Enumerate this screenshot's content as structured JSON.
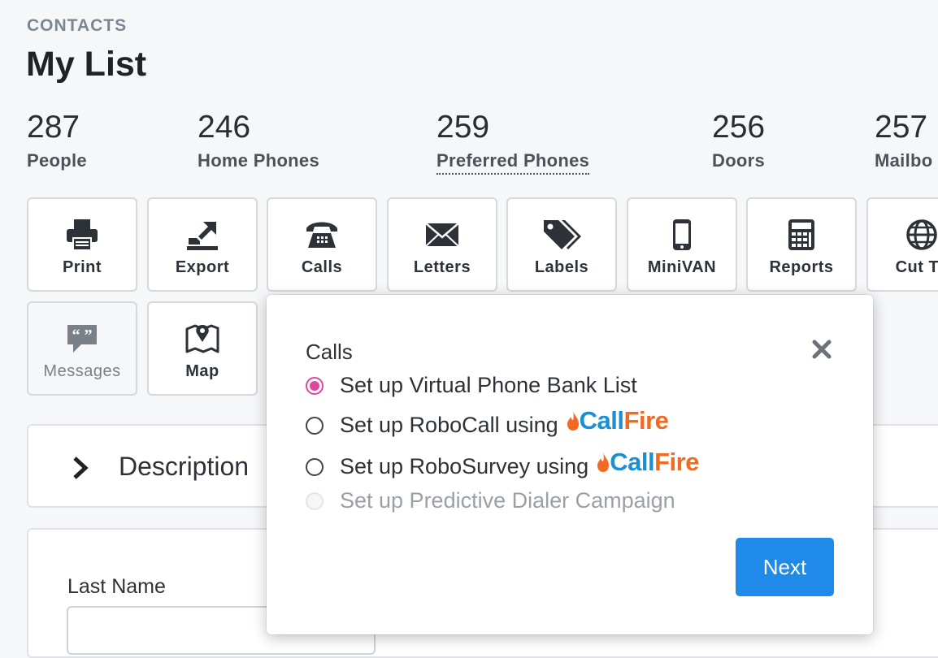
{
  "header": {
    "overline": "CONTACTS",
    "title": "My List"
  },
  "stats": [
    {
      "value": "287",
      "label": "People"
    },
    {
      "value": "246",
      "label": "Home Phones"
    },
    {
      "value": "259",
      "label": "Preferred Phones"
    },
    {
      "value": "256",
      "label": "Doors"
    },
    {
      "value": "257",
      "label": "Mailbo"
    }
  ],
  "actions": [
    {
      "label": "Print",
      "icon": "printer-icon"
    },
    {
      "label": "Export",
      "icon": "export-icon"
    },
    {
      "label": "Calls",
      "icon": "telephone-icon"
    },
    {
      "label": "Letters",
      "icon": "envelope-icon"
    },
    {
      "label": "Labels",
      "icon": "tags-icon"
    },
    {
      "label": "MiniVAN",
      "icon": "mobile-phone-icon"
    },
    {
      "label": "Reports",
      "icon": "calculator-icon"
    },
    {
      "label": "Cut Tu",
      "icon": "globe-icon"
    },
    {
      "label": "Messages",
      "icon": "quote-bubble-icon"
    },
    {
      "label": "Map",
      "icon": "map-pin-icon"
    }
  ],
  "description": {
    "label": "Description"
  },
  "form": {
    "last_name_label": "Last Name"
  },
  "calls_popover": {
    "title": "Calls",
    "options": [
      {
        "label": "Set up Virtual Phone Bank List",
        "selected": true,
        "disabled": false
      },
      {
        "label": "Set up RoboCall using",
        "selected": false,
        "disabled": false,
        "logo": "CallFire"
      },
      {
        "label": "Set up RoboSurvey using",
        "selected": false,
        "disabled": false,
        "logo": "CallFire"
      },
      {
        "label": "Set up Predictive Dialer Campaign",
        "selected": false,
        "disabled": true
      }
    ],
    "logo_parts": {
      "a": "Call",
      "b": "Fire"
    },
    "next_label": "Next"
  },
  "colors": {
    "accent": "#1f8ae8",
    "radio_selected": "#e0469b",
    "callfire_blue": "#1a8fd4",
    "callfire_orange": "#f26a21"
  }
}
